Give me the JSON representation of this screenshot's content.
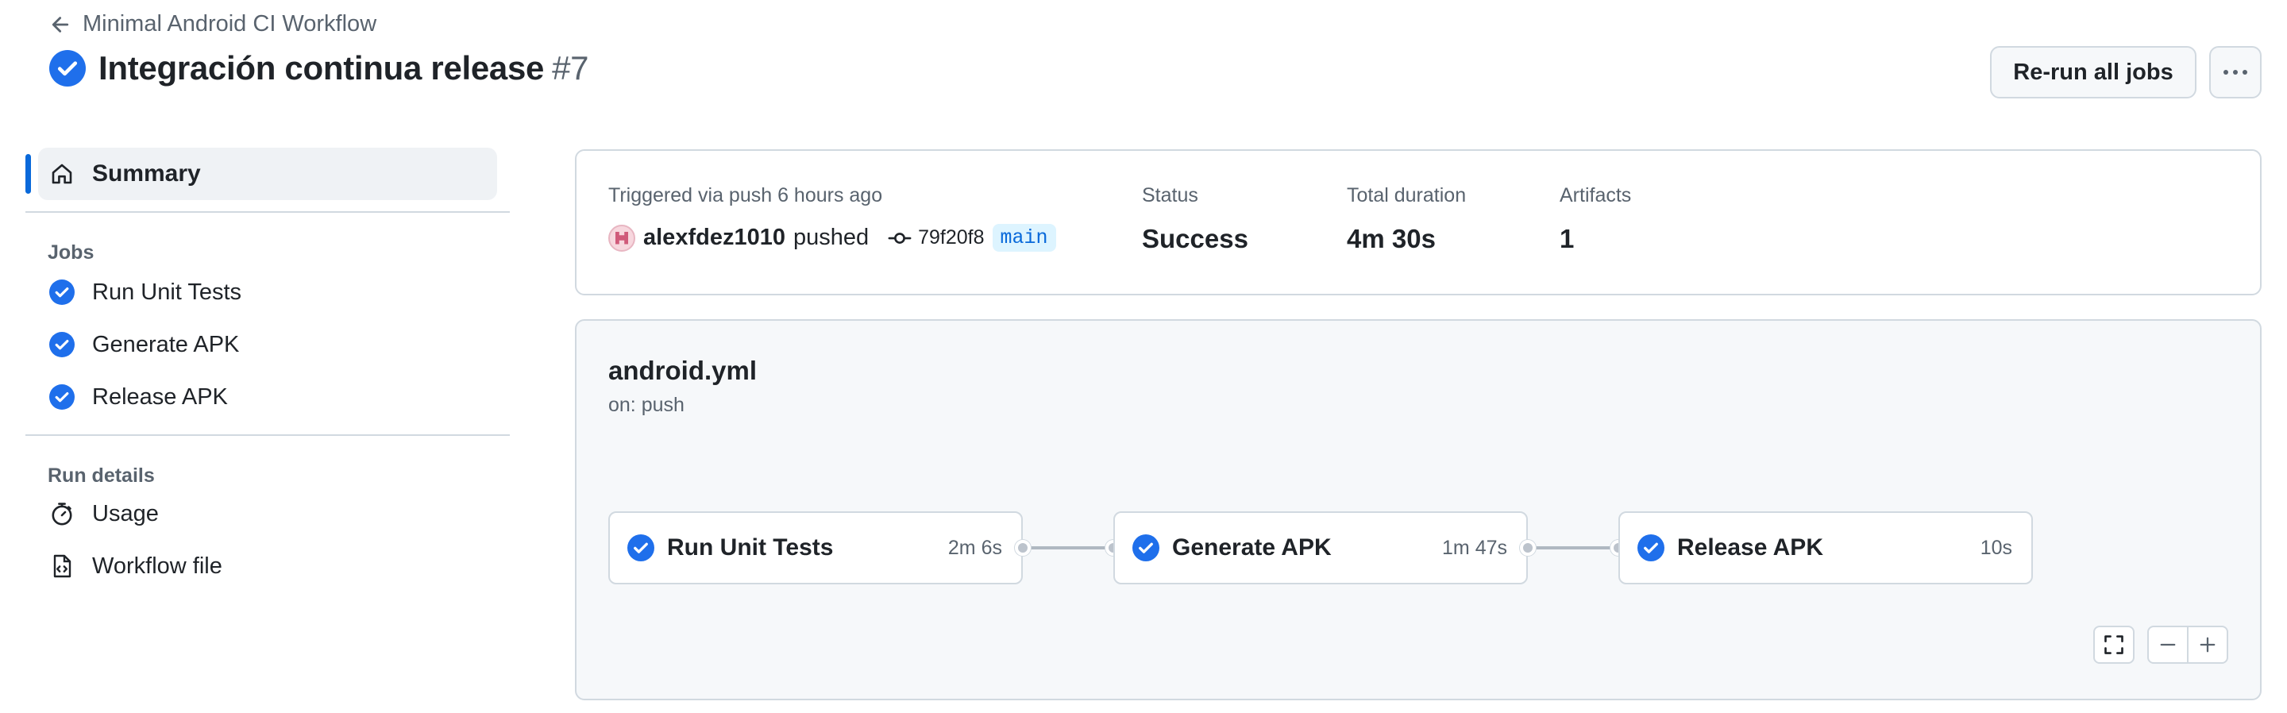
{
  "header": {
    "back_label": "Minimal Android CI Workflow",
    "run_title": "Integración continua release",
    "run_number": "#7",
    "rerun_label": "Re-run all jobs",
    "more_icon": "kebab-horizontal-icon"
  },
  "sidebar": {
    "summary_label": "Summary",
    "jobs_heading": "Jobs",
    "jobs": [
      {
        "label": "Run Unit Tests",
        "status": "success"
      },
      {
        "label": "Generate APK",
        "status": "success"
      },
      {
        "label": "Release APK",
        "status": "success"
      }
    ],
    "run_details_heading": "Run details",
    "details": [
      {
        "label": "Usage",
        "icon": "stopwatch-icon"
      },
      {
        "label": "Workflow file",
        "icon": "file-code-icon"
      }
    ]
  },
  "summary": {
    "triggered_label": "Triggered via push 6 hours ago",
    "user": "alexfdez1010",
    "action": "pushed",
    "commit_sha": "79f20f8",
    "branch": "main",
    "status_label": "Status",
    "status_value": "Success",
    "duration_label": "Total duration",
    "duration_value": "4m 30s",
    "artifacts_label": "Artifacts",
    "artifacts_value": "1"
  },
  "workflow": {
    "file_name": "android.yml",
    "trigger": "on: push",
    "jobs": [
      {
        "name": "Run Unit Tests",
        "duration": "2m 6s",
        "status": "success"
      },
      {
        "name": "Generate APK",
        "duration": "1m 47s",
        "status": "success"
      },
      {
        "name": "Release APK",
        "duration": "10s",
        "status": "success"
      }
    ]
  },
  "colors": {
    "success": "#1f6feb",
    "accent": "#0969da",
    "border": "#d1d9e0",
    "muted_text": "#59636e"
  }
}
